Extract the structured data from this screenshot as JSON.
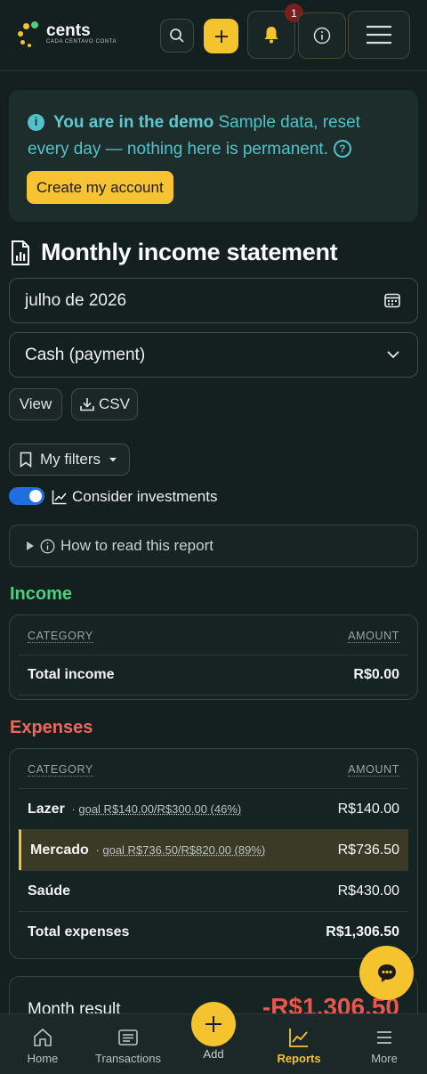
{
  "brand": {
    "name": "cents",
    "tagline": "CADA CENTAVO CONTA"
  },
  "header": {
    "notification_count": "1"
  },
  "banner": {
    "bold": "You are in the demo",
    "text": " Sample data, reset every day — nothing here is permanent.",
    "cta": "Create my account"
  },
  "page": {
    "title": "Monthly income statement"
  },
  "filters": {
    "month": "julho de 2026",
    "basis": "Cash (payment)",
    "view_label": "View",
    "csv_label": "CSV",
    "my_filters_label": "My filters",
    "investments_label": "Consider investments",
    "investments_on": true,
    "how_to_read": "How to read this report"
  },
  "income": {
    "title": "Income",
    "col_category": "CATEGORY",
    "col_amount": "AMOUNT",
    "total_label": "Total income",
    "total_value": "R$0.00"
  },
  "expenses": {
    "title": "Expenses",
    "col_category": "CATEGORY",
    "col_amount": "AMOUNT",
    "rows": [
      {
        "name": "Lazer",
        "goal": "goal R$140.00/R$300.00 (46%)",
        "amount": "R$140.00"
      },
      {
        "name": "Mercado",
        "goal": "goal R$736.50/R$820.00 (89%)",
        "amount": "R$736.50"
      },
      {
        "name": "Saúde",
        "goal": "",
        "amount": "R$430.00"
      }
    ],
    "total_label": "Total expenses",
    "total_value": "R$1,306.50"
  },
  "result": {
    "label": "Month result",
    "value": "-R$1,306.50"
  },
  "nav": {
    "home": "Home",
    "transactions": "Transactions",
    "add": "Add",
    "reports": "Reports",
    "more": "More"
  },
  "colors": {
    "accent": "#f5c32e",
    "income": "#4cd07d",
    "expense": "#f0665c",
    "info": "#4fc3c9"
  }
}
